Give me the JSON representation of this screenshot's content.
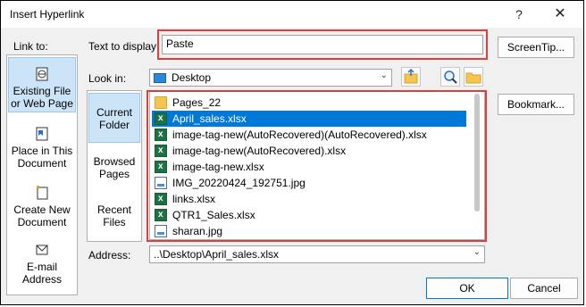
{
  "window": {
    "title": "Insert Hyperlink",
    "help": "?",
    "close": "✕"
  },
  "link_to": {
    "label": "Link to:",
    "items": [
      {
        "line1": "Existing File",
        "line2": "or Web Page",
        "selected": true
      },
      {
        "line1": "Place in This",
        "line2": "Document",
        "selected": false
      },
      {
        "line1": "Create New",
        "line2": "Document",
        "selected": false
      },
      {
        "line1": "E-mail",
        "line2": "Address",
        "selected": false
      }
    ]
  },
  "text_to_display": {
    "label": "Text to display:",
    "value": "Paste"
  },
  "screentip_button": "ScreenTip...",
  "look_in": {
    "label": "Look in:",
    "value": "Desktop"
  },
  "sub_nav": [
    {
      "line1": "Current",
      "line2": "Folder",
      "selected": true
    },
    {
      "line1": "Browsed",
      "line2": "Pages",
      "selected": false
    },
    {
      "line1": "Recent",
      "line2": "Files",
      "selected": false
    }
  ],
  "files": [
    {
      "name": "Pages_22",
      "type": "folder",
      "selected": false
    },
    {
      "name": "April_sales.xlsx",
      "type": "xlsx",
      "selected": true
    },
    {
      "name": "image-tag-new(AutoRecovered)(AutoRecovered).xlsx",
      "type": "xlsx",
      "selected": false
    },
    {
      "name": "image-tag-new(AutoRecovered).xlsx",
      "type": "xlsx",
      "selected": false
    },
    {
      "name": "image-tag-new.xlsx",
      "type": "xlsx",
      "selected": false
    },
    {
      "name": "IMG_20220424_192751.jpg",
      "type": "jpg",
      "selected": false
    },
    {
      "name": "links.xlsx",
      "type": "xlsx",
      "selected": false
    },
    {
      "name": "QTR1_Sales.xlsx",
      "type": "xlsx",
      "selected": false
    },
    {
      "name": "sharan.jpg",
      "type": "jpg",
      "selected": false
    }
  ],
  "bookmark_button": "Bookmark...",
  "address": {
    "label": "Address:",
    "value": "..\\Desktop\\April_sales.xlsx"
  },
  "ok_button": "OK",
  "cancel_button": "Cancel",
  "colors": {
    "highlight_box": "#d94040",
    "selection": "#0078d7",
    "nav_selected": "#cce4f7"
  }
}
